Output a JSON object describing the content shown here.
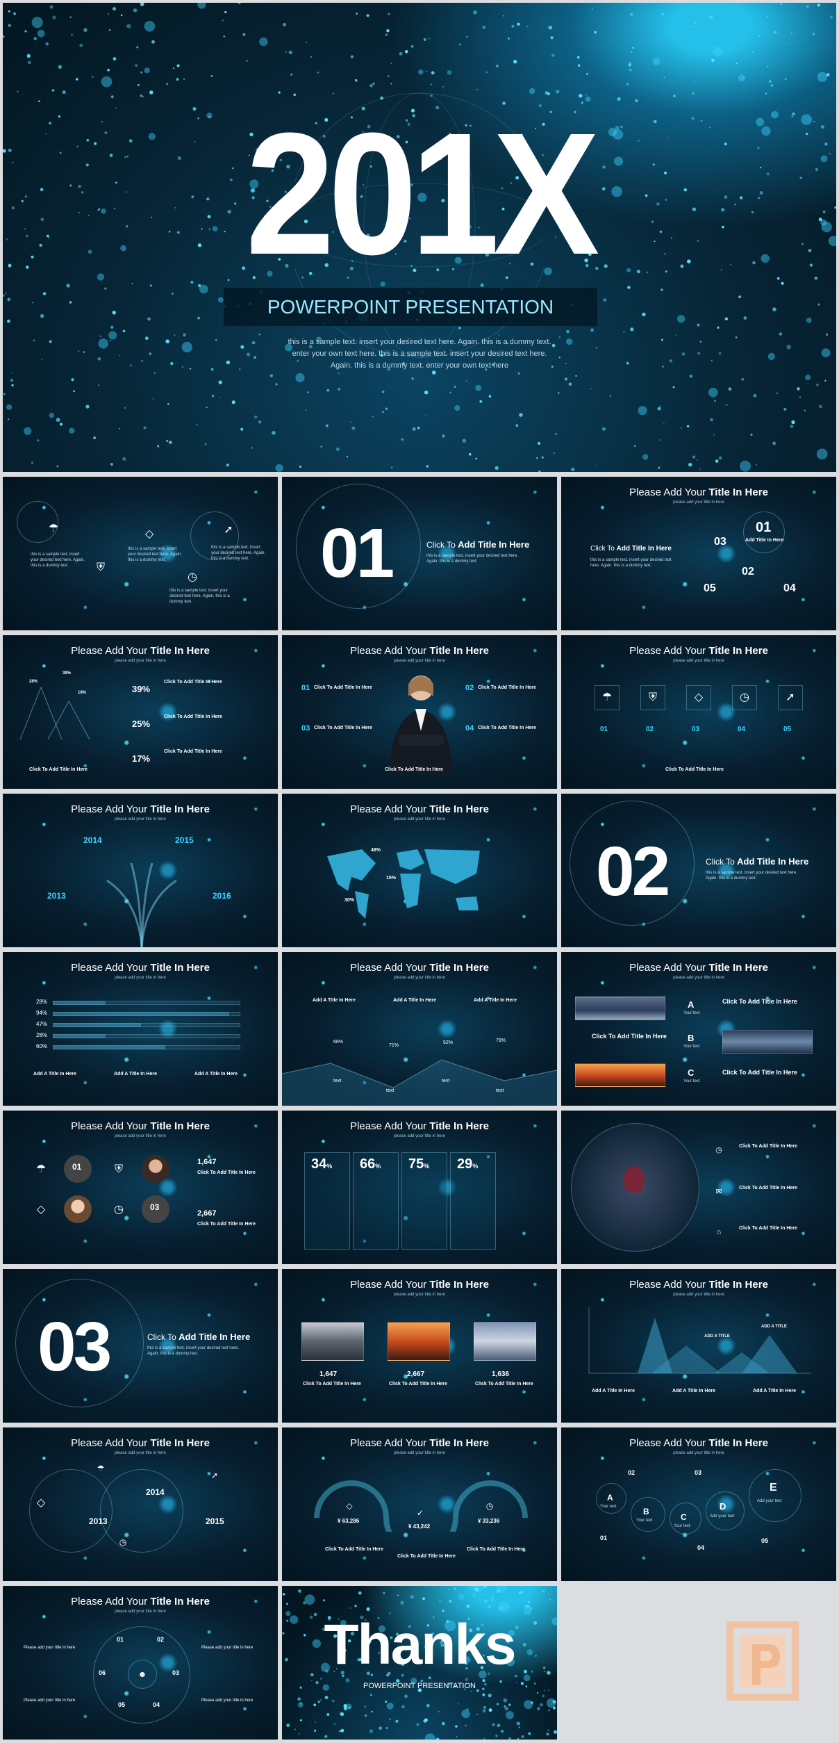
{
  "cover": {
    "year": "201X",
    "subtitle": "POWERPOINT PRESENTATION",
    "desc": "this is a sample text. insert your desired text here. Again. this is a dummy text. enter your own text here. this is a sample text. insert your desired text here. Again. this is a dummy text. enter your own text here"
  },
  "common": {
    "title_prefix": "Please Add Your ",
    "title_bold": "Title In Here",
    "subtitle": "please add your title in here",
    "click_prefix": "Click To ",
    "click_bold": "Add Title In Here"
  },
  "slides": {
    "s1": {
      "text": "this is a sample text. insert your desired text here. Again. this is a dummy text."
    },
    "s2": {
      "number": "01"
    },
    "s3": {
      "n1": "01",
      "n2": "02",
      "n3": "03",
      "n4": "04",
      "n5": "05",
      "add": "Add Title In Here",
      "addt": "Add Title In Here"
    },
    "s4": {
      "p1": "39%",
      "p2": "25%",
      "p3": "17%",
      "t1": "39%",
      "t2": "28%",
      "t3": "19%",
      "bottom": "Click To Add Title In Here"
    },
    "s5": {
      "n1": "01",
      "n2": "02",
      "n3": "03",
      "n4": "04",
      "bottom": "Click To Add Title In Here"
    },
    "s6": {
      "n1": "01",
      "n2": "02",
      "n3": "03",
      "n4": "04",
      "n5": "05",
      "bottom": "Click To Add Title In Here"
    },
    "s7": {
      "y1": "2014",
      "y2": "2015",
      "y3": "2013",
      "y4": "2016"
    },
    "s8": {
      "p1": "48%",
      "p2": "15%",
      "p3": "30%"
    },
    "s9": {
      "number": "02"
    },
    "s10": {
      "p1": "28%",
      "p2": "94%",
      "p3": "47%",
      "p4": "28%",
      "p5": "60%",
      "a1": "Add A Title In Here",
      "a2": "Add A Title In Here",
      "a3": "Add A Title In Here"
    },
    "s11": {
      "a1": "Add A Title In Here",
      "a2": "Add A Title In Here",
      "a3": "Add A Title In Here",
      "p1": "68%",
      "p2": "71%",
      "p3": "52%",
      "p4": "79%",
      "t1": "text",
      "t2": "text",
      "t3": "text",
      "t4": "text"
    },
    "s12": {
      "a": "A",
      "b": "B",
      "c": "C",
      "yt": "Your text"
    },
    "s13": {
      "n1": "01",
      "n3": "03",
      "v1": "1,647",
      "v2": "2,667"
    },
    "s14": {
      "p1": "34",
      "p2": "66",
      "p3": "75",
      "p4": "29",
      "pct": "%"
    },
    "s16": {
      "number": "03"
    },
    "s17": {
      "v1": "1,647",
      "v2": "2,667",
      "v3": "1,636"
    },
    "s18": {
      "t1": "ADD A TITLE",
      "t2": "ADD A TITLE",
      "a1": "Add A Title In Here",
      "a2": "Add A Title In Here",
      "a3": "Add A Title In Here"
    },
    "s19": {
      "y1": "2014",
      "y2": "2013",
      "y3": "2015"
    },
    "s20": {
      "v1": "¥ 63,286",
      "v2": "¥ 43,242",
      "v3": "¥ 33,236"
    },
    "s21": {
      "n1": "02",
      "n2": "03",
      "n3": "01",
      "n4": "04",
      "n5": "05",
      "a": "A",
      "b": "B",
      "c": "C",
      "d": "D",
      "e": "E",
      "yt": "Your text",
      "ayt": "Add your text"
    },
    "s22": {
      "n1": "01",
      "n2": "02",
      "n3": "03",
      "n4": "04",
      "n5": "05",
      "n6": "06",
      "p": "Please add your title in here"
    },
    "s23": {
      "thanks": "Thanks",
      "sub": "POWERPOINT PRESENTATION"
    }
  },
  "colors": {
    "accent": "#3fd3ff",
    "bg": "#062033"
  },
  "icons": [
    "umbrella-icon",
    "diamond-icon",
    "shield-icon",
    "clock-icon",
    "trend-icon"
  ]
}
